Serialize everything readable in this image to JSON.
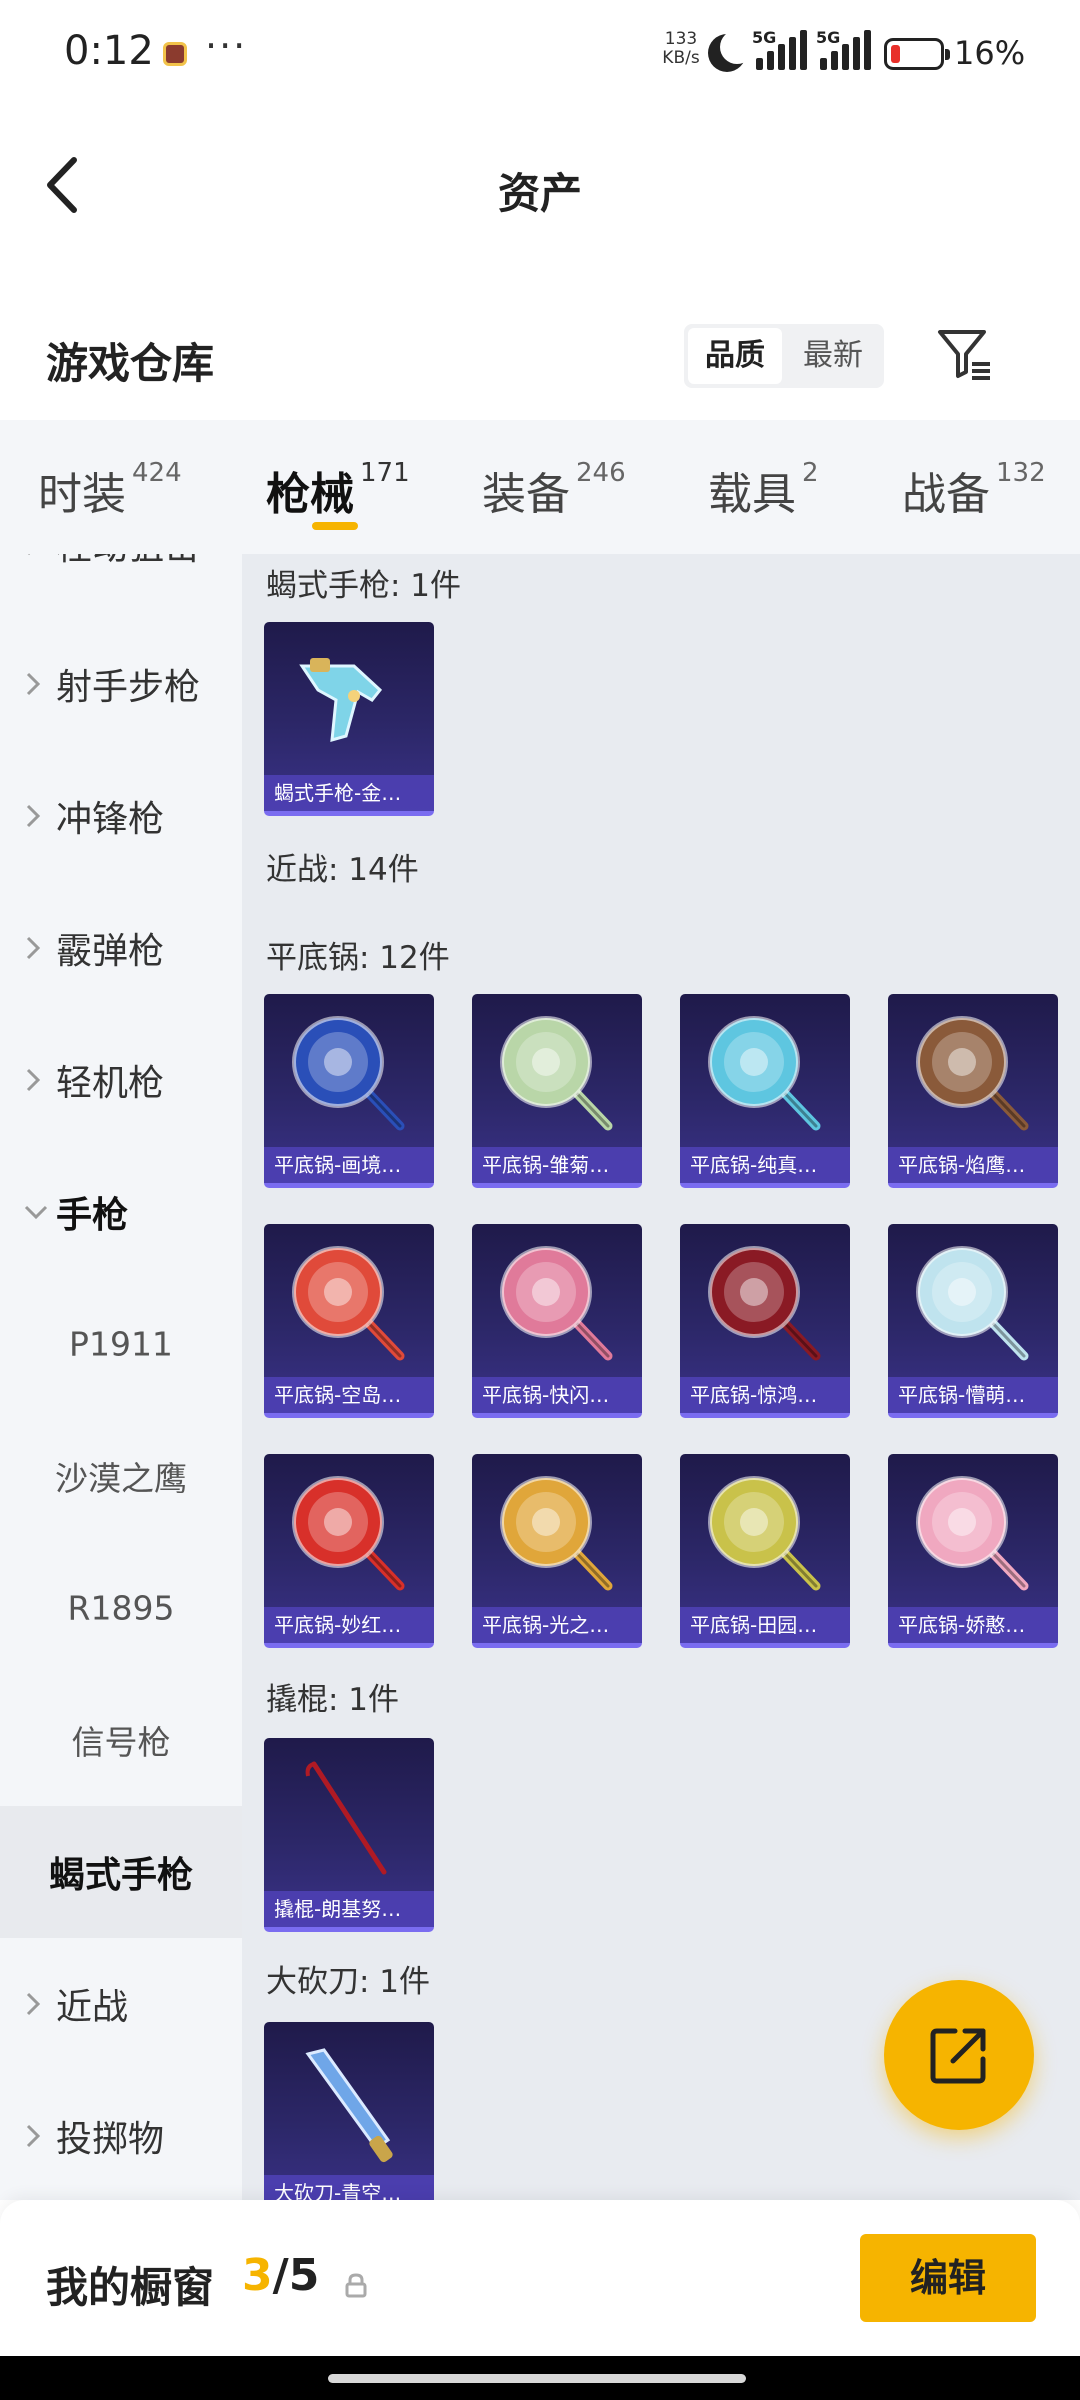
{
  "status_bar": {
    "time": "0:12",
    "net_speed_value": "133",
    "net_speed_unit": "KB/s",
    "signal_1": "5G",
    "signal_2": "5G",
    "battery": "16%"
  },
  "header": {
    "title": "资产"
  },
  "warehouse": {
    "title": "游戏仓库",
    "sort_options": [
      "品质",
      "最新"
    ],
    "active_sort": "品质"
  },
  "tabs": [
    {
      "label": "时装",
      "count": "424"
    },
    {
      "label": "枪械",
      "count": "171",
      "active": true
    },
    {
      "label": "装备",
      "count": "246"
    },
    {
      "label": "载具",
      "count": "2"
    },
    {
      "label": "战备",
      "count": "132"
    }
  ],
  "sidebar": {
    "items": [
      {
        "label": "栓动狙击",
        "kind": "collapsed"
      },
      {
        "label": "射手步枪",
        "kind": "collapsed"
      },
      {
        "label": "冲锋枪",
        "kind": "collapsed"
      },
      {
        "label": "霰弹枪",
        "kind": "collapsed"
      },
      {
        "label": "轻机枪",
        "kind": "collapsed"
      },
      {
        "label": "手枪",
        "kind": "expanded"
      },
      {
        "label": "P1911",
        "kind": "sub"
      },
      {
        "label": "沙漠之鹰",
        "kind": "sub"
      },
      {
        "label": "R1895",
        "kind": "sub"
      },
      {
        "label": "信号枪",
        "kind": "sub"
      },
      {
        "label": "蝎式手枪",
        "kind": "selected"
      },
      {
        "label": "近战",
        "kind": "collapsed"
      },
      {
        "label": "投掷物",
        "kind": "collapsed"
      }
    ]
  },
  "content": {
    "groups": [
      {
        "head": "蝎式手枪: 1件",
        "items": [
          {
            "name": "蝎式手枪-金…",
            "icon": "scorpion-pistol-skin"
          }
        ]
      },
      {
        "head": "近战: 14件",
        "items": []
      },
      {
        "head": "平底锅: 12件",
        "items": [
          {
            "name": "平底锅-画境…",
            "icon": "pan-skin",
            "color": "#2a4fb8"
          },
          {
            "name": "平底锅-雏菊…",
            "icon": "pan-skin",
            "color": "#b9d6a8"
          },
          {
            "name": "平底锅-纯真…",
            "icon": "pan-skin",
            "color": "#5ec6e0"
          },
          {
            "name": "平底锅-焰鹰…",
            "icon": "pan-skin",
            "color": "#8a5a3a"
          },
          {
            "name": "平底锅-空岛…",
            "icon": "pan-skin",
            "color": "#e04a3a"
          },
          {
            "name": "平底锅-快闪…",
            "icon": "pan-skin",
            "color": "#e07a9a"
          },
          {
            "name": "平底锅-惊鸿…",
            "icon": "pan-skin",
            "color": "#8a1a24"
          },
          {
            "name": "平底锅-懵萌…",
            "icon": "pan-skin",
            "color": "#bfe3ee"
          },
          {
            "name": "平底锅-妙红…",
            "icon": "pan-skin",
            "color": "#d8302a"
          },
          {
            "name": "平底锅-光之…",
            "icon": "pan-skin",
            "color": "#e0a63a"
          },
          {
            "name": "平底锅-田园…",
            "icon": "pan-skin",
            "color": "#c9c24a"
          },
          {
            "name": "平底锅-娇憨…",
            "icon": "pan-skin",
            "color": "#f0a8c0"
          }
        ]
      },
      {
        "head": "撬棍: 1件",
        "items": [
          {
            "name": "撬棍-朗基努…",
            "icon": "crowbar-skin"
          }
        ]
      },
      {
        "head": "大砍刀: 1件",
        "items": [
          {
            "name": "大砍刀-青空…",
            "icon": "machete-skin"
          }
        ]
      }
    ]
  },
  "fab": {
    "icon": "share-external-icon"
  },
  "showcase": {
    "label": "我的橱窗",
    "current": "3",
    "total": "/5",
    "edit_label": "编辑"
  },
  "colors": {
    "accent": "#f6b400",
    "card_bg": "#2c2768",
    "card_caption": "#4e40b4"
  }
}
